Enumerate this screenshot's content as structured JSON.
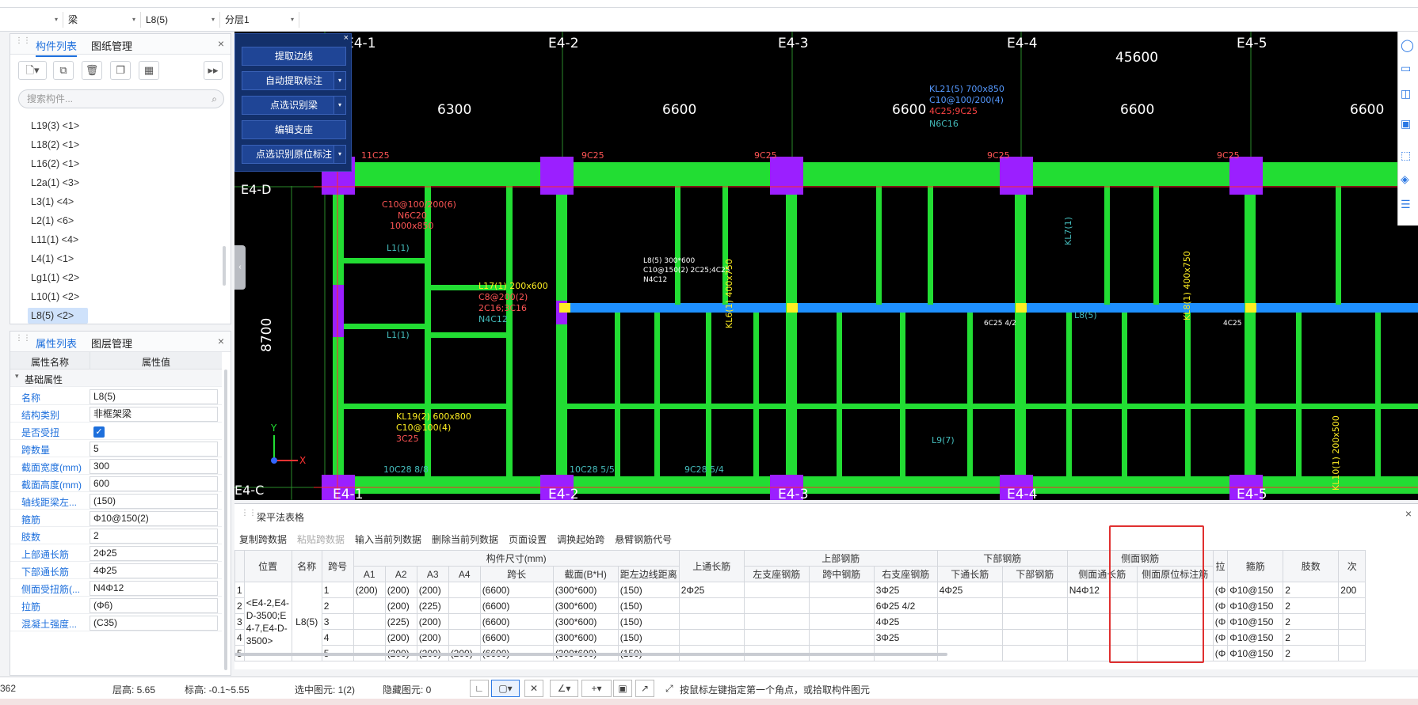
{
  "top_filters": {
    "type_value": "梁",
    "name_value": "L8(5)",
    "floor_value": "分层1"
  },
  "component_panel": {
    "tabs": [
      "构件列表",
      "图纸管理"
    ],
    "search_placeholder": "搜索构件...",
    "items": [
      "L19(3) <1>",
      "L18(2) <1>",
      "L16(2) <1>",
      "L2a(1) <3>",
      "L3(1) <4>",
      "L2(1) <6>",
      "L11(1) <4>",
      "L4(1) <1>",
      "Lg1(1) <2>",
      "L10(1) <2>",
      "L8(5) <2>"
    ],
    "selected": "L8(5) <2>"
  },
  "property_panel": {
    "tabs": [
      "属性列表",
      "图层管理"
    ],
    "col_name": "属性名称",
    "col_value": "属性值",
    "group": "基础属性",
    "rows": [
      {
        "name": "名称",
        "value": "L8(5)"
      },
      {
        "name": "结构类别",
        "value": "非框架梁"
      },
      {
        "name": "是否受扭",
        "value": ""
      },
      {
        "name": "跨数量",
        "value": "5"
      },
      {
        "name": "截面宽度(mm)",
        "value": "300"
      },
      {
        "name": "截面高度(mm)",
        "value": "600"
      },
      {
        "name": "轴线距梁左...",
        "value": "(150)"
      },
      {
        "name": "箍筋",
        "value": "Φ10@150(2)"
      },
      {
        "name": "肢数",
        "value": "2"
      },
      {
        "name": "上部通长筋",
        "value": "2Φ25"
      },
      {
        "name": "下部通长筋",
        "value": "4Φ25"
      },
      {
        "name": "侧面受扭筋(...",
        "value": "N4Φ12"
      },
      {
        "name": "拉筋",
        "value": "(Φ6)"
      },
      {
        "name": "混凝土强度...",
        "value": "(C35)"
      }
    ]
  },
  "float_menu": [
    "提取边线",
    "自动提取标注",
    "点选识别梁",
    "编辑支座",
    "点选识别原位标注"
  ],
  "drawing": {
    "axes_top": [
      "E4-1",
      "E4-2",
      "E4-3",
      "E4-4",
      "E4-5"
    ],
    "axes_bottom": [
      "E4-1",
      "E4-2",
      "E4-3",
      "E4-4",
      "E4-5"
    ],
    "total_dim": "45600",
    "spans": [
      "6300",
      "6600",
      "6600",
      "6600",
      "6600"
    ],
    "side_dim": "8700",
    "row_d": "E4-D",
    "row_c": "E4-C",
    "labels": [
      "KL21(5) 700x850",
      "C10@100/200(4)",
      "4C25;9C25",
      "N6C16",
      "C10@100/200(6)",
      "N6C20",
      "1000x850",
      "L8(5) 300*600",
      "C10@150(2) 2C25;4C25",
      "N4C12",
      "L17(1) 200x600",
      "C8@200(2)",
      "2C16;3C16",
      "N4C12",
      "KL19(2) 600x800",
      "C10@100(4)",
      "3C25",
      "6C25 4/2",
      "4C25",
      "L8(5)",
      "11C25",
      "9C25",
      "9C25",
      "9C25",
      "9C25",
      "L9(7)",
      "10C28 8/8",
      "10C28 5/5",
      "9C28 5/4",
      "KL6(1) 400x750",
      "KL8(1) 400x750",
      "L1(1)",
      "L1(1)",
      "KL7(1)",
      "KL10(1) 200x500"
    ]
  },
  "table_panel": {
    "title": "梁平法表格",
    "toolbar": [
      "复制跨数据",
      "粘贴跨数据",
      "输入当前列数据",
      "删除当前列数据",
      "页面设置",
      "调换起始跨",
      "悬臂钢筋代号"
    ],
    "group_headers": [
      "构件尺寸(mm)",
      "上部钢筋",
      "下部钢筋",
      "侧面钢筋"
    ],
    "headers": [
      "位置",
      "名称",
      "跨号",
      "A1",
      "A2",
      "A3",
      "A4",
      "跨长",
      "截面(B*H)",
      "距左边线距离",
      "上通长筋",
      "左支座钢筋",
      "跨中钢筋",
      "右支座钢筋",
      "下通长筋",
      "下部钢筋",
      "侧面通长筋",
      "侧面原位标注筋",
      "拉",
      "箍筋",
      "肢数",
      "次"
    ],
    "position": "<E4-2,E4-D-3500;E4-7,E4-D-3500>",
    "name": "L8(5)",
    "rows": [
      {
        "idx": "1",
        "span": "1",
        "a1": "(200)",
        "a2": "(200)",
        "a3": "(200)",
        "a4": "",
        "len": "(6600)",
        "sec": "(300*600)",
        "dist": "(150)",
        "top": "2Φ25",
        "left": "",
        "mid": "",
        "right": "3Φ25",
        "bot_through": "4Φ25",
        "bot": "",
        "side": "N4Φ12",
        "side_orig": "",
        "la": "(Φ",
        "stirrup": "Φ10@150",
        "legs": "2",
        "ci": "200"
      },
      {
        "idx": "2",
        "span": "2",
        "a1": "",
        "a2": "(200)",
        "a3": "(225)",
        "a4": "",
        "len": "(6600)",
        "sec": "(300*600)",
        "dist": "(150)",
        "top": "",
        "left": "",
        "mid": "",
        "right": "6Φ25 4/2",
        "bot_through": "",
        "bot": "",
        "side": "",
        "side_orig": "",
        "la": "(Φ",
        "stirrup": "Φ10@150",
        "legs": "2",
        "ci": ""
      },
      {
        "idx": "3",
        "span": "3",
        "a1": "",
        "a2": "(225)",
        "a3": "(200)",
        "a4": "",
        "len": "(6600)",
        "sec": "(300*600)",
        "dist": "(150)",
        "top": "",
        "left": "",
        "mid": "",
        "right": "4Φ25",
        "bot_through": "",
        "bot": "",
        "side": "",
        "side_orig": "",
        "la": "(Φ",
        "stirrup": "Φ10@150",
        "legs": "2",
        "ci": ""
      },
      {
        "idx": "4",
        "span": "4",
        "a1": "",
        "a2": "(200)",
        "a3": "(200)",
        "a4": "",
        "len": "(6600)",
        "sec": "(300*600)",
        "dist": "(150)",
        "top": "",
        "left": "",
        "mid": "",
        "right": "3Φ25",
        "bot_through": "",
        "bot": "",
        "side": "",
        "side_orig": "",
        "la": "(Φ",
        "stirrup": "Φ10@150",
        "legs": "2",
        "ci": ""
      },
      {
        "idx": "5",
        "span": "5",
        "a1": "",
        "a2": "(200)",
        "a3": "(200)",
        "a4": "(200)",
        "len": "(6600)",
        "sec": "(300*600)",
        "dist": "(150)",
        "top": "",
        "left": "",
        "mid": "",
        "right": "",
        "bot_through": "",
        "bot": "",
        "side": "",
        "side_orig": "",
        "la": "(Φ",
        "stirrup": "Φ10@150",
        "legs": "2",
        "ci": ""
      }
    ]
  },
  "status": {
    "coord": "362",
    "floor_height": "层高:   5.65",
    "elevation": "标高:   -0.1~5.55",
    "selected": "选中图元: 1(2)",
    "hidden": "隐藏图元: 0",
    "hint": "按鼠标左键指定第一个角点，或拾取构件图元"
  }
}
